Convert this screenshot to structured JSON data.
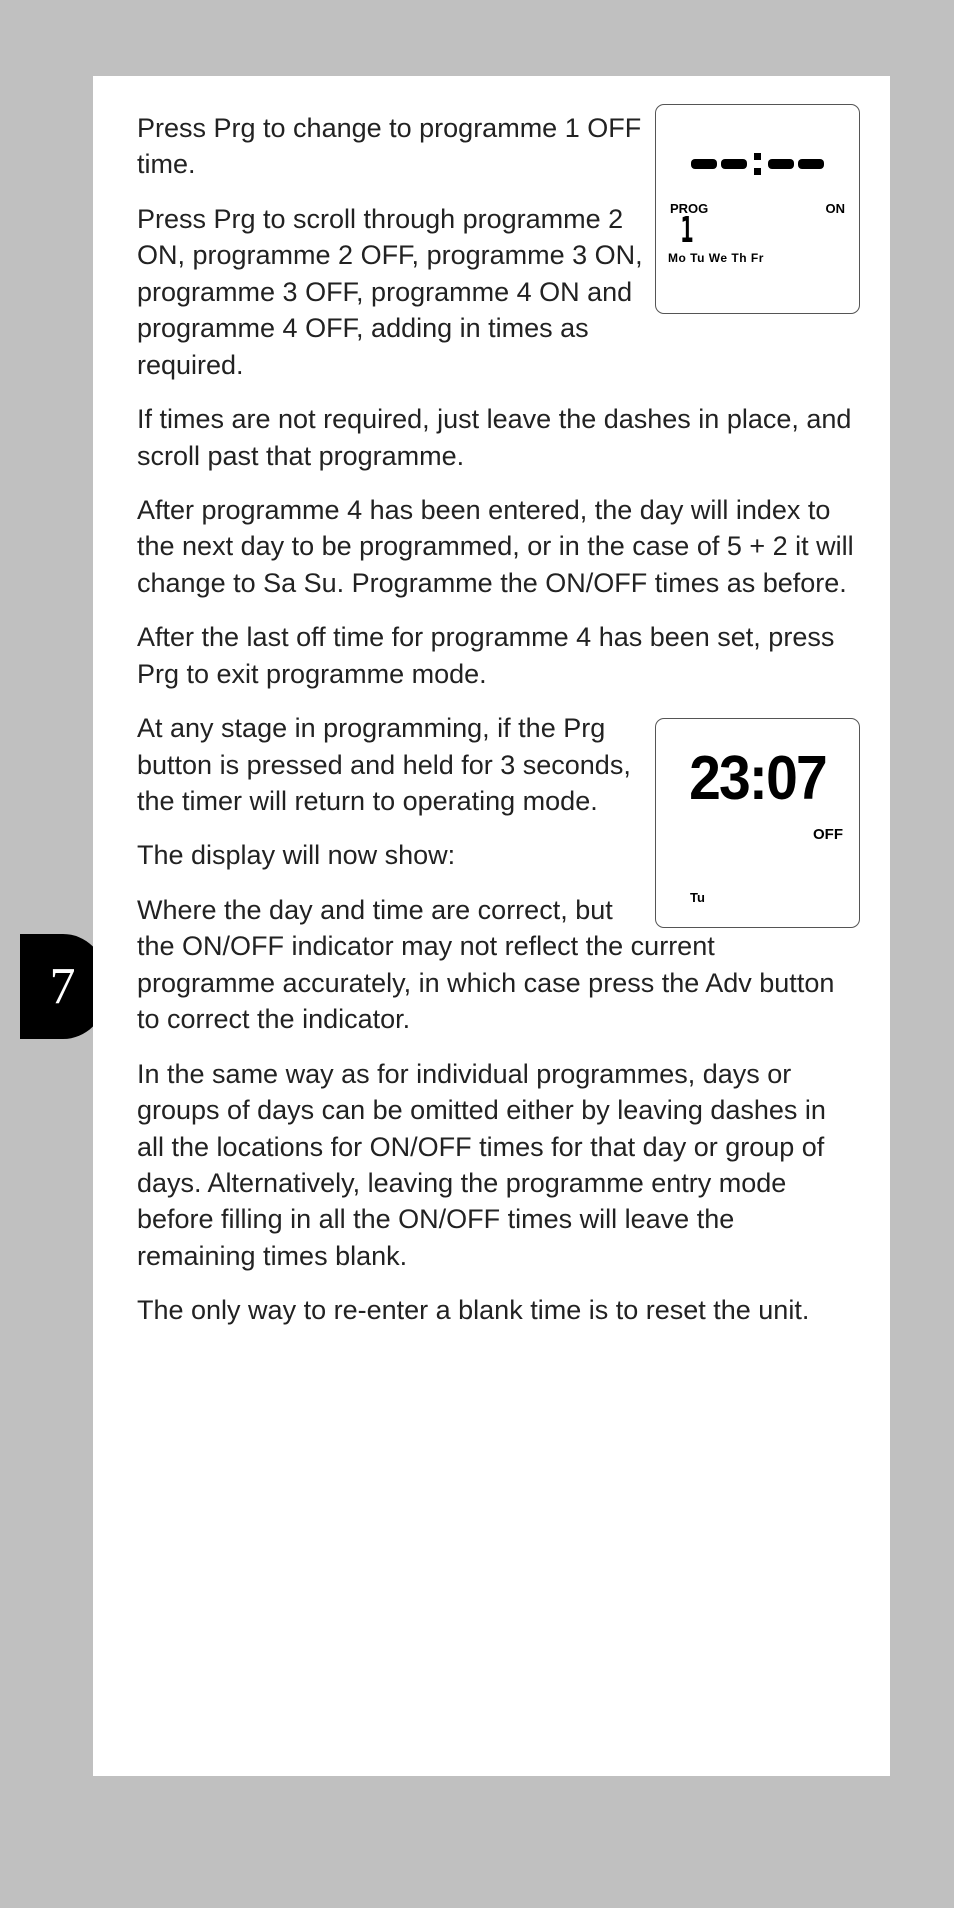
{
  "pageNumber": "7",
  "paragraphs": {
    "p1": "Press Prg to change to programme 1 OFF time.",
    "p2": "Press Prg to scroll through programme 2 ON, programme 2 OFF, programme 3 ON, programme 3 OFF, programme 4 ON and programme 4 OFF, adding in times as required.",
    "p3": "If times are not required, just leave the dashes in place, and scroll past that programme.",
    "p4": "After programme 4 has been entered, the day will index to the next day to be programmed, or in the case of 5 + 2 it will change to Sa Su. Programme the ON/OFF times as before.",
    "p5": "After the last off time for programme 4 has been set, press Prg to exit programme mode.",
    "p6": "At any stage in programming, if the Prg button is pressed and held for 3 seconds, the timer will return to operating mode.",
    "p7": "The display will now show:",
    "p8": "Where the day and time are correct, but the ON/OFF indicator may not reflect the current programme accurately, in which case press the Adv button to correct the indicator.",
    "p9": "In the same way as for individual programmes, days or groups of days can be omitted either by leaving dashes in all the locations for ON/OFF times for that day or group of days. Alternatively, leaving the programme entry mode before filling in all the ON/OFF times will leave the remaining times blank.",
    "p10": "The only way to re-enter a blank time is to reset the unit."
  },
  "lcd1": {
    "progLabel": "PROG",
    "onLabel": "ON",
    "progNumber": "1",
    "days": "Mo Tu We Th Fr"
  },
  "lcd2": {
    "time": "23:07",
    "offLabel": "OFF",
    "day": "Tu"
  }
}
